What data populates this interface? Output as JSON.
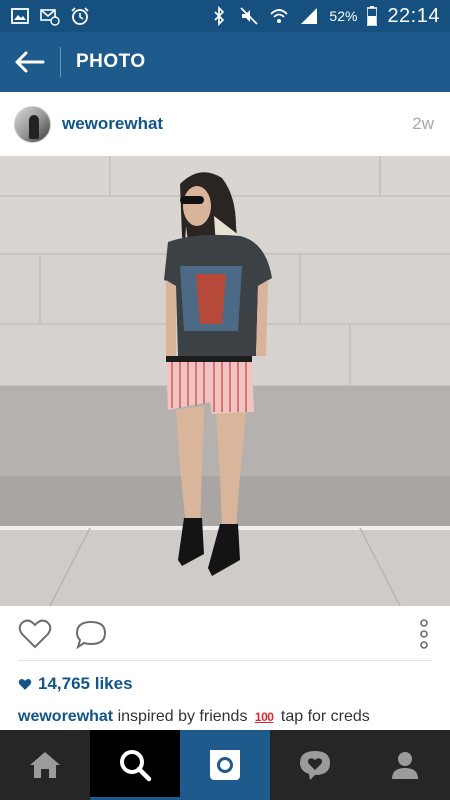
{
  "statusbar": {
    "icons_left": [
      "gallery-icon",
      "mail-sync-icon",
      "alarm-icon"
    ],
    "icons_right": [
      "bluetooth-icon",
      "mute-icon",
      "wifi-icon",
      "signal-icon"
    ],
    "battery": "52%",
    "time": "22:14"
  },
  "appbar": {
    "title": "PHOTO"
  },
  "post": {
    "username": "weworewhat",
    "time_ago": "2w",
    "likes": "14,765 likes",
    "caption_user": "weworewhat",
    "caption_text_before": "inspired by friends",
    "caption_emoji": "100",
    "caption_text_after": "tap for creds"
  },
  "colors": {
    "status_bar": "#16507e",
    "app_bar": "#1f5a8c",
    "link_blue": "#125688",
    "bottom_nav": "#262626"
  },
  "bottom_nav": {
    "items": [
      "home-icon",
      "search-icon",
      "camera-icon",
      "activity-icon",
      "profile-icon"
    ],
    "active": "search-icon"
  }
}
